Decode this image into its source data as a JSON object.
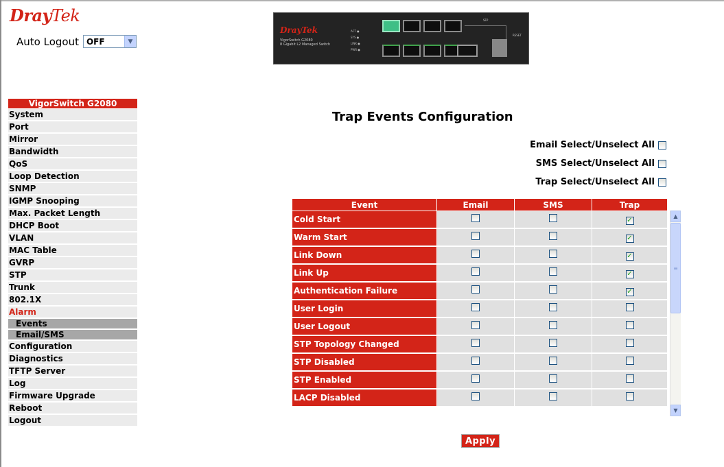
{
  "header": {
    "brand_dray": "Dray",
    "brand_tek": "Tek",
    "auto_logout_label": "Auto Logout",
    "auto_logout_value": "OFF"
  },
  "device": {
    "logo": "DrayTek",
    "model_line1": "VigorSwitch G2080",
    "model_line2": "8 Gigabit L2 Managed Switch"
  },
  "sidebar": {
    "title": "VigorSwitch G2080",
    "items_top": [
      "System",
      "Port",
      "Mirror",
      "Bandwidth",
      "QoS",
      "Loop Detection",
      "SNMP",
      "IGMP Snooping",
      "Max. Packet Length",
      "DHCP Boot",
      "VLAN",
      "MAC Table",
      "GVRP",
      "STP",
      "Trunk",
      "802.1X"
    ],
    "active_item": "Alarm",
    "sub_items": [
      "Events",
      "Email/SMS"
    ],
    "items_bottom": [
      "Configuration",
      "Diagnostics",
      "TFTP Server",
      "Log",
      "Firmware Upgrade",
      "Reboot",
      "Logout"
    ]
  },
  "main": {
    "title": "Trap Events Configuration",
    "email_select_all": "Email Select/Unselect All",
    "sms_select_all": "SMS Select/Unselect All",
    "trap_select_all": "Trap Select/Unselect All",
    "columns": [
      "Event",
      "Email",
      "SMS",
      "Trap"
    ],
    "rows": [
      {
        "event": "Cold Start",
        "email": false,
        "sms": false,
        "trap": true
      },
      {
        "event": "Warm Start",
        "email": false,
        "sms": false,
        "trap": true
      },
      {
        "event": "Link Down",
        "email": false,
        "sms": false,
        "trap": true
      },
      {
        "event": "Link Up",
        "email": false,
        "sms": false,
        "trap": true
      },
      {
        "event": "Authentication Failure",
        "email": false,
        "sms": false,
        "trap": true
      },
      {
        "event": "User Login",
        "email": false,
        "sms": false,
        "trap": false
      },
      {
        "event": "User Logout",
        "email": false,
        "sms": false,
        "trap": false
      },
      {
        "event": "STP Topology Changed",
        "email": false,
        "sms": false,
        "trap": false
      },
      {
        "event": "STP Disabled",
        "email": false,
        "sms": false,
        "trap": false
      },
      {
        "event": "STP Enabled",
        "email": false,
        "sms": false,
        "trap": false
      },
      {
        "event": "LACP Disabled",
        "email": false,
        "sms": false,
        "trap": false
      }
    ],
    "apply_label": "Apply"
  },
  "icons": {
    "checkbox_checked": "checkmark-icon",
    "scroll_up": "arrow-up-icon",
    "scroll_down": "arrow-down-icon"
  },
  "colors": {
    "brand_red": "#d32418",
    "sidebar_bg": "#ebebeb",
    "submenu_bg": "#a7a7a7",
    "cell_bg": "#e0e0e0"
  }
}
